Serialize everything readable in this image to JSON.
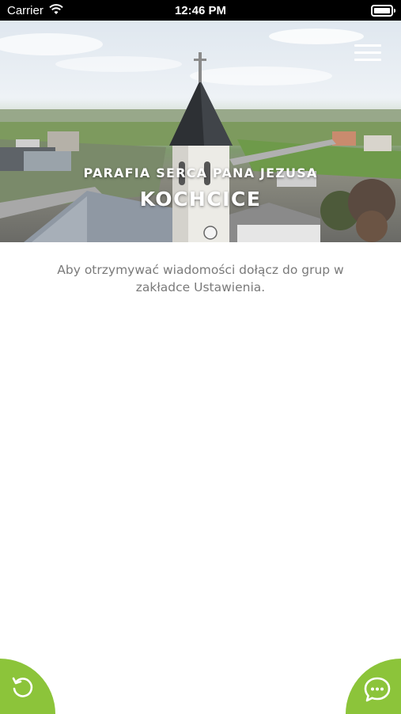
{
  "status_bar": {
    "carrier": "Carrier",
    "time": "12:46 PM"
  },
  "hero": {
    "subtitle": "PARAFIA SERCA PANA JEZUSA",
    "title": "KOCHCICE",
    "menu_icon": "hamburger-menu-icon"
  },
  "main": {
    "info_text": "Aby otrzymywać wiadomości dołącz do grup w zakładce Ustawienia."
  },
  "fabs": {
    "left_icon": "refresh-icon",
    "right_icon": "chat-icon",
    "color": "#8cc43a"
  }
}
